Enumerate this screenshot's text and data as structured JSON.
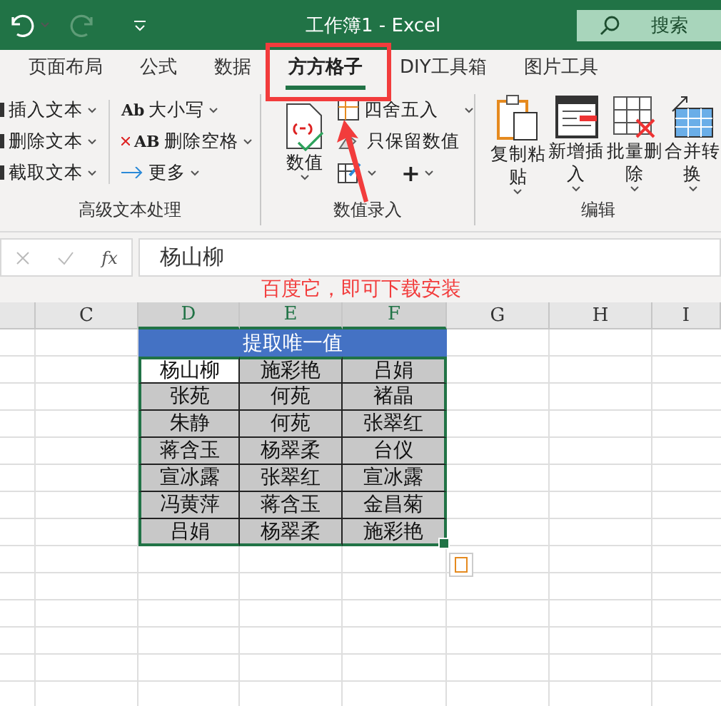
{
  "title_bar": {
    "title": "工作簿1  -  Excel",
    "search": {
      "placeholder": "搜索"
    }
  },
  "tabs": [
    {
      "label": "页面布局",
      "selected": false
    },
    {
      "label": "公式",
      "selected": false
    },
    {
      "label": "数据",
      "selected": false
    },
    {
      "label": "方方格子",
      "selected": true
    },
    {
      "label": "DIY工具箱",
      "selected": false
    },
    {
      "label": "图片工具",
      "selected": false
    }
  ],
  "ribbon": {
    "text_group": {
      "label": "高级文本处理",
      "column_1": [
        "插入文本",
        "删除文本",
        "截取文本"
      ],
      "column_2": [
        {
          "badge": "Ab",
          "label": "大小写"
        },
        {
          "badge": "AB",
          "label": "删除空格"
        },
        {
          "label": "更多"
        }
      ]
    },
    "number_group": {
      "label": "数值录入",
      "big_button": "数值",
      "small": [
        {
          "kind": "dropdown",
          "label": "四舍五入"
        },
        {
          "kind": "plain",
          "label": "只保留数值"
        },
        {
          "kind": "icons",
          "symbol": "+"
        }
      ]
    },
    "edit_group": {
      "label": "编辑",
      "buttons": [
        "复制粘贴",
        "新增插入",
        "批量删除",
        "合并转换"
      ]
    }
  },
  "formula_bar": {
    "function_label": "fx",
    "value": "杨山柳"
  },
  "annotation": {
    "text": "百度它，即可下载安装"
  },
  "sheet": {
    "columns": [
      {
        "label": "C",
        "selected": false
      },
      {
        "label": "D",
        "selected": true
      },
      {
        "label": "E",
        "selected": true
      },
      {
        "label": "F",
        "selected": true
      },
      {
        "label": "G",
        "selected": false
      },
      {
        "label": "H",
        "selected": false
      },
      {
        "label": "I",
        "selected": false
      }
    ],
    "table": {
      "header": "提取唯一值",
      "rows": [
        [
          {
            "text": "杨山柳",
            "active": true
          },
          {
            "text": "施彩艳",
            "active": false
          },
          {
            "text": "吕娟",
            "active": false
          }
        ],
        [
          {
            "text": "张苑",
            "active": false
          },
          {
            "text": "何苑",
            "active": false
          },
          {
            "text": "褚晶",
            "active": false
          }
        ],
        [
          {
            "text": "朱静",
            "active": false
          },
          {
            "text": "何苑",
            "active": false
          },
          {
            "text": "张翠红",
            "active": false
          }
        ],
        [
          {
            "text": "蒋含玉",
            "active": false
          },
          {
            "text": "杨翠柔",
            "active": false
          },
          {
            "text": "台仪",
            "active": false
          }
        ],
        [
          {
            "text": "宣冰露",
            "active": false
          },
          {
            "text": "张翠红",
            "active": false
          },
          {
            "text": "宣冰露",
            "active": false
          }
        ],
        [
          {
            "text": "冯黄萍",
            "active": false
          },
          {
            "text": "蒋含玉",
            "active": false
          },
          {
            "text": "金昌菊",
            "active": false
          }
        ],
        [
          {
            "text": "吕娟",
            "active": false
          },
          {
            "text": "杨翠柔",
            "active": false
          },
          {
            "text": "施彩艳",
            "active": false
          }
        ]
      ]
    }
  }
}
